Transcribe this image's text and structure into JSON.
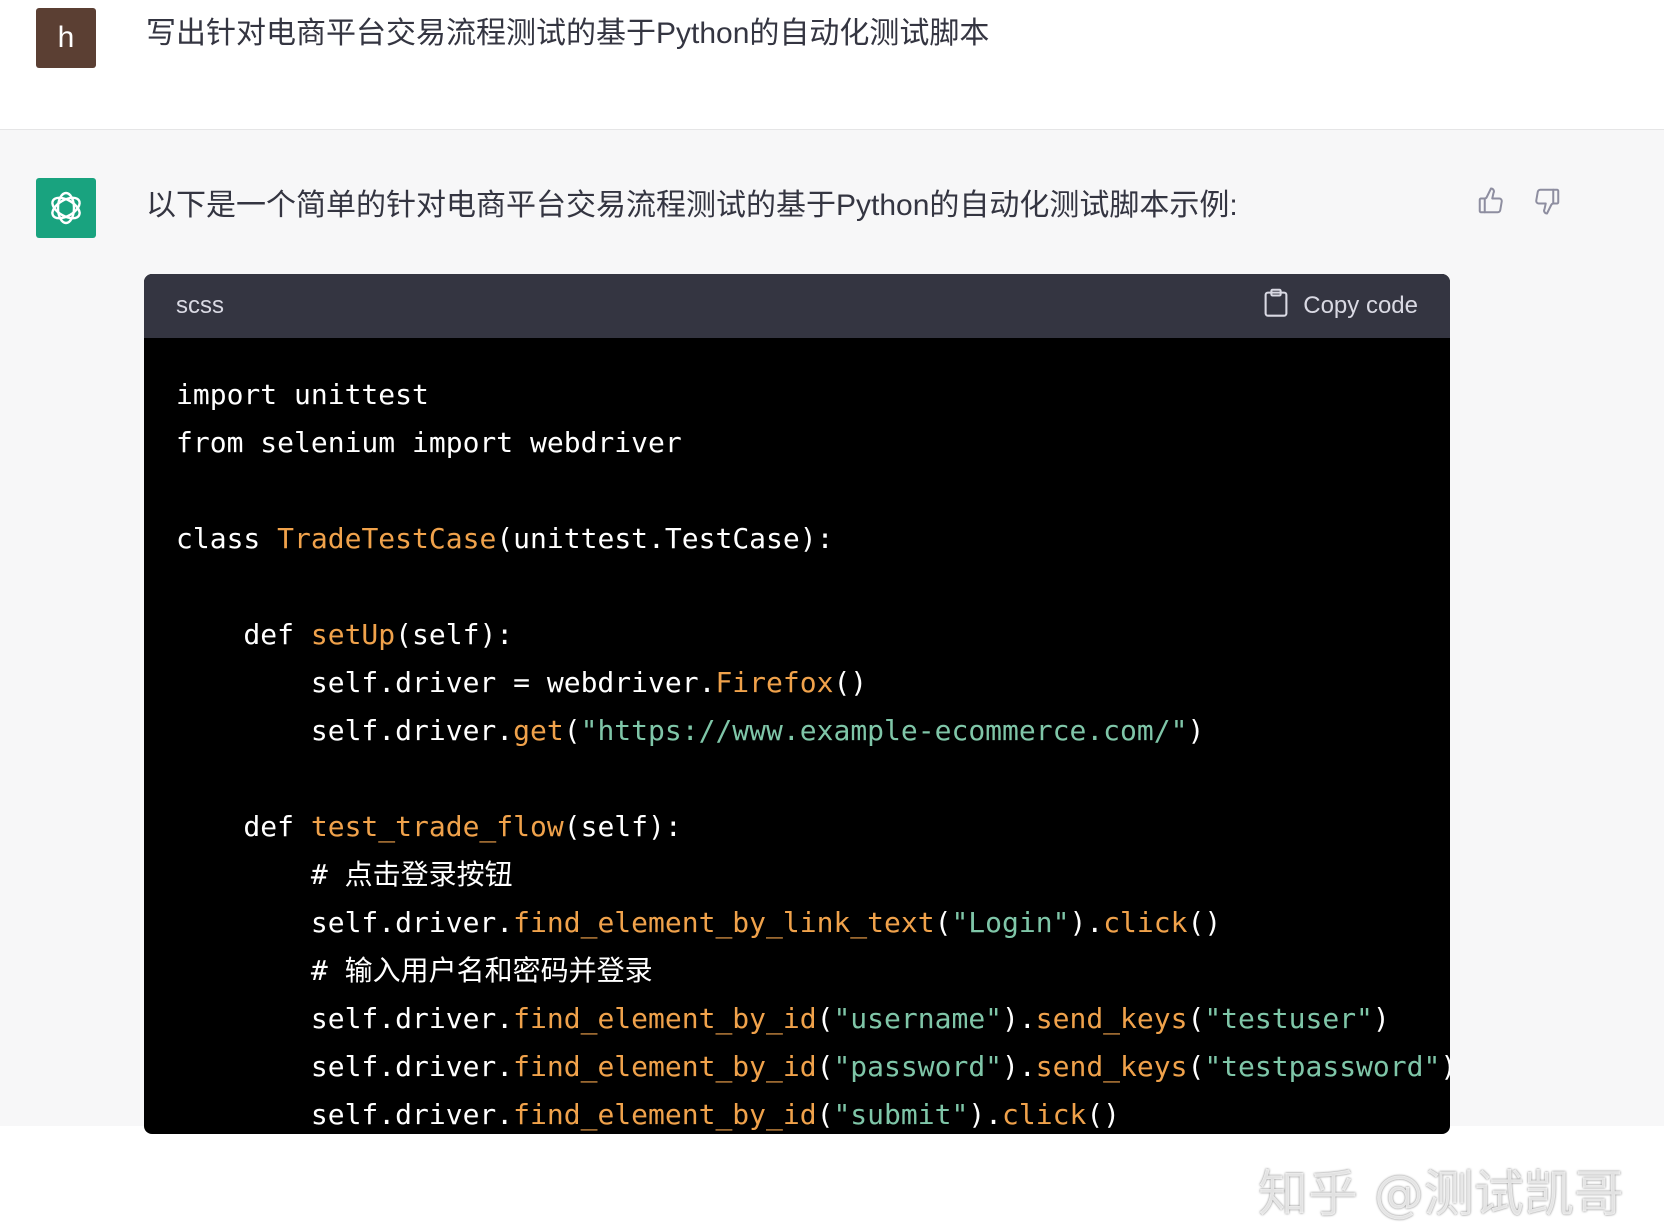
{
  "user": {
    "avatar_letter": "h",
    "message": "写出针对电商平台交易流程测试的基于Python的自动化测试脚本"
  },
  "assistant": {
    "message": "以下是一个简单的针对电商平台交易流程测试的基于Python的自动化测试脚本示例:",
    "feedback": {
      "up_icon": "thumbs-up-icon",
      "down_icon": "thumbs-down-icon"
    }
  },
  "code_block": {
    "language": "scss",
    "copy_label": "Copy code",
    "lines": [
      [
        {
          "t": "import unittest",
          "c": "kw"
        }
      ],
      [
        {
          "t": "from selenium import webdriver",
          "c": "kw"
        }
      ],
      [],
      [
        {
          "t": "class ",
          "c": "kw"
        },
        {
          "t": "TradeTestCase",
          "c": "fn"
        },
        {
          "t": "(unittest.TestCase):",
          "c": "kw"
        }
      ],
      [],
      [
        {
          "t": "    def ",
          "c": "kw"
        },
        {
          "t": "setUp",
          "c": "fn"
        },
        {
          "t": "(self):",
          "c": "kw"
        }
      ],
      [
        {
          "t": "        self.driver = webdriver.",
          "c": "kw"
        },
        {
          "t": "Firefox",
          "c": "fn"
        },
        {
          "t": "()",
          "c": "kw"
        }
      ],
      [
        {
          "t": "        self.driver.",
          "c": "kw"
        },
        {
          "t": "get",
          "c": "fn"
        },
        {
          "t": "(",
          "c": "kw"
        },
        {
          "t": "\"https://www.example-ecommerce.com/\"",
          "c": "str"
        },
        {
          "t": ")",
          "c": "kw"
        }
      ],
      [],
      [
        {
          "t": "    def ",
          "c": "kw"
        },
        {
          "t": "test_trade_flow",
          "c": "fn"
        },
        {
          "t": "(self):",
          "c": "kw"
        }
      ],
      [
        {
          "t": "        # 点击登录按钮",
          "c": "cm"
        }
      ],
      [
        {
          "t": "        self.driver.",
          "c": "kw"
        },
        {
          "t": "find_element_by_link_text",
          "c": "fn"
        },
        {
          "t": "(",
          "c": "kw"
        },
        {
          "t": "\"Login\"",
          "c": "str"
        },
        {
          "t": ").",
          "c": "kw"
        },
        {
          "t": "click",
          "c": "fn"
        },
        {
          "t": "()",
          "c": "kw"
        }
      ],
      [
        {
          "t": "        # 输入用户名和密码并登录",
          "c": "cm"
        }
      ],
      [
        {
          "t": "        self.driver.",
          "c": "kw"
        },
        {
          "t": "find_element_by_id",
          "c": "fn"
        },
        {
          "t": "(",
          "c": "kw"
        },
        {
          "t": "\"username\"",
          "c": "str"
        },
        {
          "t": ").",
          "c": "kw"
        },
        {
          "t": "send_keys",
          "c": "fn"
        },
        {
          "t": "(",
          "c": "kw"
        },
        {
          "t": "\"testuser\"",
          "c": "str"
        },
        {
          "t": ")",
          "c": "kw"
        }
      ],
      [
        {
          "t": "        self.driver.",
          "c": "kw"
        },
        {
          "t": "find_element_by_id",
          "c": "fn"
        },
        {
          "t": "(",
          "c": "kw"
        },
        {
          "t": "\"password\"",
          "c": "str"
        },
        {
          "t": ").",
          "c": "kw"
        },
        {
          "t": "send_keys",
          "c": "fn"
        },
        {
          "t": "(",
          "c": "kw"
        },
        {
          "t": "\"testpassword\"",
          "c": "str"
        },
        {
          "t": ")",
          "c": "kw"
        }
      ],
      [
        {
          "t": "        self.driver.",
          "c": "kw"
        },
        {
          "t": "find_element_by_id",
          "c": "fn"
        },
        {
          "t": "(",
          "c": "kw"
        },
        {
          "t": "\"submit\"",
          "c": "str"
        },
        {
          "t": ").",
          "c": "kw"
        },
        {
          "t": "click",
          "c": "fn"
        },
        {
          "t": "()",
          "c": "kw"
        }
      ]
    ]
  },
  "watermark": "知乎 @测试凯哥",
  "colors": {
    "user_avatar": "#5b3f33",
    "bot_avatar": "#19a37f",
    "code_bg": "#000000",
    "code_header": "#343541",
    "function": "#f0a24b",
    "string": "#7fc6a8"
  }
}
